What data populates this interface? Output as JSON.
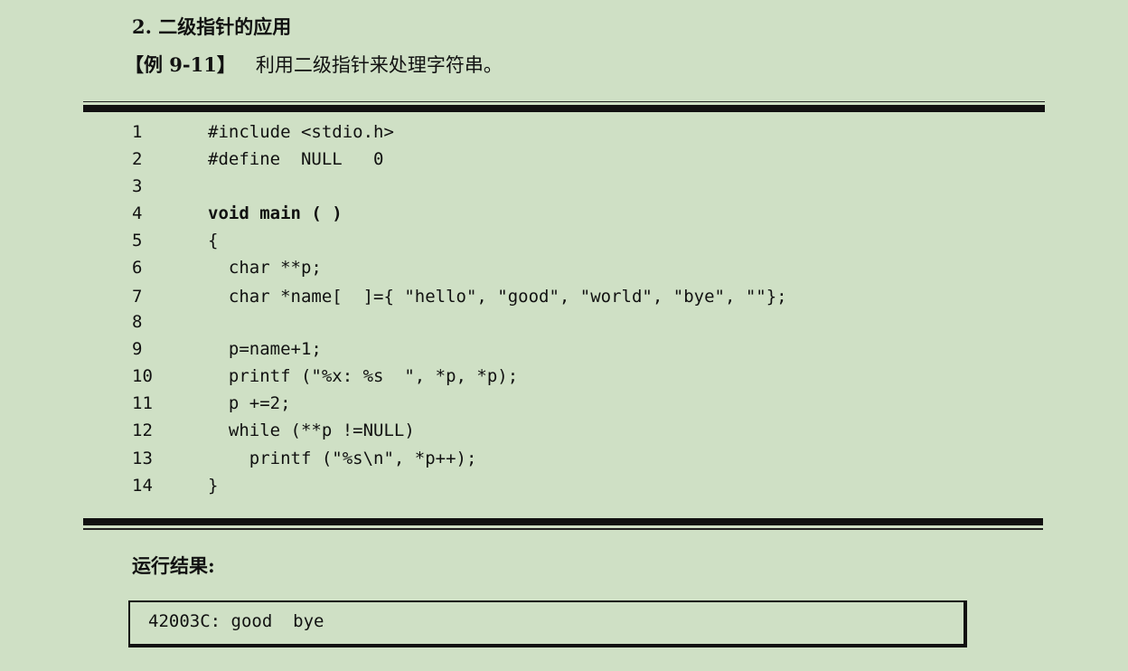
{
  "section": {
    "heading": "2. 二级指针的应用"
  },
  "example": {
    "label": "【例 9-11】",
    "description": "利用二级指针来处理字符串。"
  },
  "code": {
    "lines": [
      {
        "number": "1",
        "text": "#include <stdio.h>"
      },
      {
        "number": "2",
        "text": "#define  NULL   0"
      },
      {
        "number": "3",
        "text": ""
      },
      {
        "number": "4",
        "text": "void main ( )"
      },
      {
        "number": "5",
        "text": "{"
      },
      {
        "number": "6",
        "text": "  char **p;"
      },
      {
        "number": "7",
        "text": "  char *name[  ]={ \"hello\", \"good\", \"world\", \"bye\", \"\"};"
      },
      {
        "number": "8",
        "text": ""
      },
      {
        "number": "9",
        "text": "  p=name+1;"
      },
      {
        "number": "10",
        "text": "  printf (\"%x: %s  \", *p, *p);"
      },
      {
        "number": "11",
        "text": "  p +=2;"
      },
      {
        "number": "12",
        "text": "  while (**p !=NULL)"
      },
      {
        "number": "13",
        "text": "    printf (\"%s\\n\", *p++);"
      },
      {
        "number": "14",
        "text": "}"
      }
    ]
  },
  "result": {
    "label": "运行结果:",
    "output": "42003C: good  bye"
  }
}
